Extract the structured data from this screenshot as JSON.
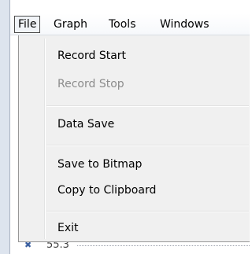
{
  "menubar": {
    "items": [
      {
        "label": "File",
        "active": true
      },
      {
        "label": "Graph"
      },
      {
        "label": "Tools"
      },
      {
        "label": "Windows"
      }
    ]
  },
  "file_menu": {
    "items": [
      {
        "label": "Record Start",
        "enabled": true
      },
      {
        "label": "Record Stop",
        "enabled": false
      },
      {
        "label": "Data Save",
        "enabled": true
      },
      {
        "label": "Save to Bitmap",
        "enabled": true
      },
      {
        "label": "Copy to Clipboard",
        "enabled": true
      },
      {
        "label": "Exit",
        "enabled": true
      }
    ]
  },
  "background": {
    "axis_value": "55.3",
    "axis_marker_icon": "x-axis-marker-icon"
  },
  "colors": {
    "menu_background": "#f0f0f0",
    "disabled_text": "#8c8c8c",
    "active_border": "#4a4a4a"
  }
}
